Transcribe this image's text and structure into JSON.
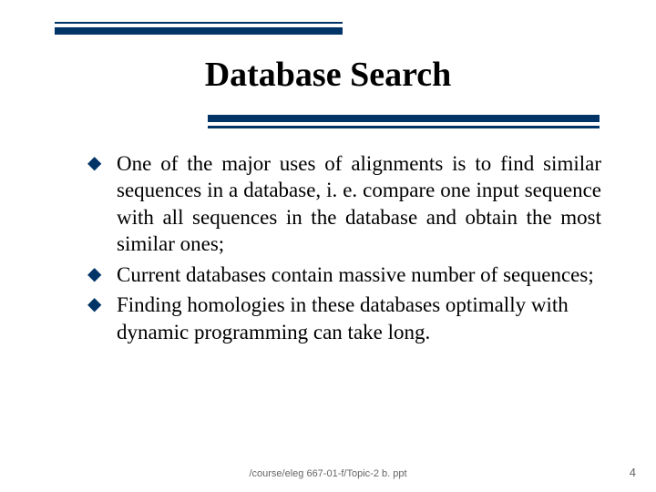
{
  "title": "Database Search",
  "bullets": [
    {
      "text": "One of the major uses of alignments is to find similar sequences in a database, i. e. compare one input sequence with all sequences in the database and obtain the most similar ones;",
      "justify": true
    },
    {
      "text": "Current databases contain massive number of sequences;",
      "justify": false
    },
    {
      "text": "Finding homologies in these databases optimally with dynamic programming can take long.",
      "justify": false
    }
  ],
  "footer": {
    "path": "/course/eleg 667-01-f/Topic-2 b. ppt",
    "page": "4"
  }
}
